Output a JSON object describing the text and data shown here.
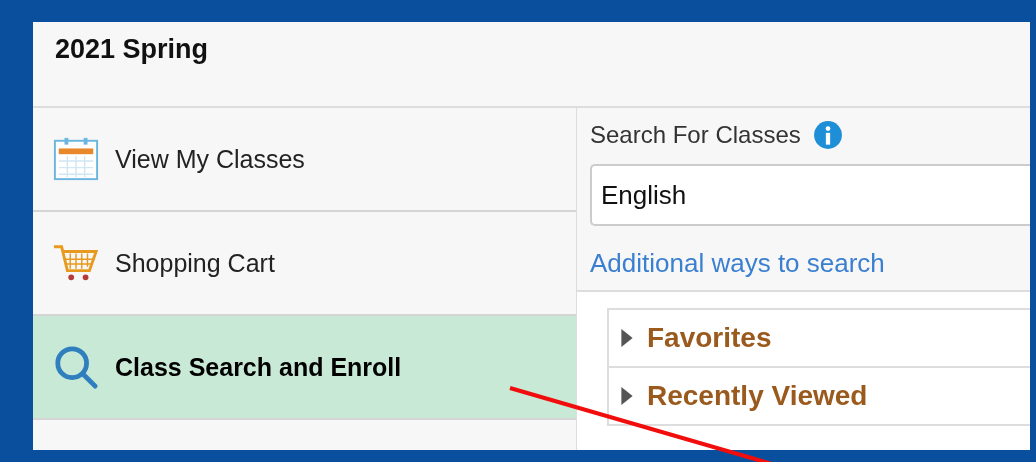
{
  "header": {
    "title": "2021 Spring"
  },
  "sidebar": {
    "items": [
      {
        "label": "View My Classes",
        "kind": "calendar",
        "selected": false
      },
      {
        "label": "Shopping Cart",
        "kind": "cart",
        "selected": false
      },
      {
        "label": "Class Search and Enroll",
        "kind": "search",
        "selected": true
      }
    ]
  },
  "search": {
    "label": "Search For Classes",
    "value": "English",
    "link": "Additional ways to search"
  },
  "sections": [
    {
      "label": "Favorites",
      "expanded": false
    },
    {
      "label": "Recently Viewed",
      "expanded": false
    }
  ]
}
